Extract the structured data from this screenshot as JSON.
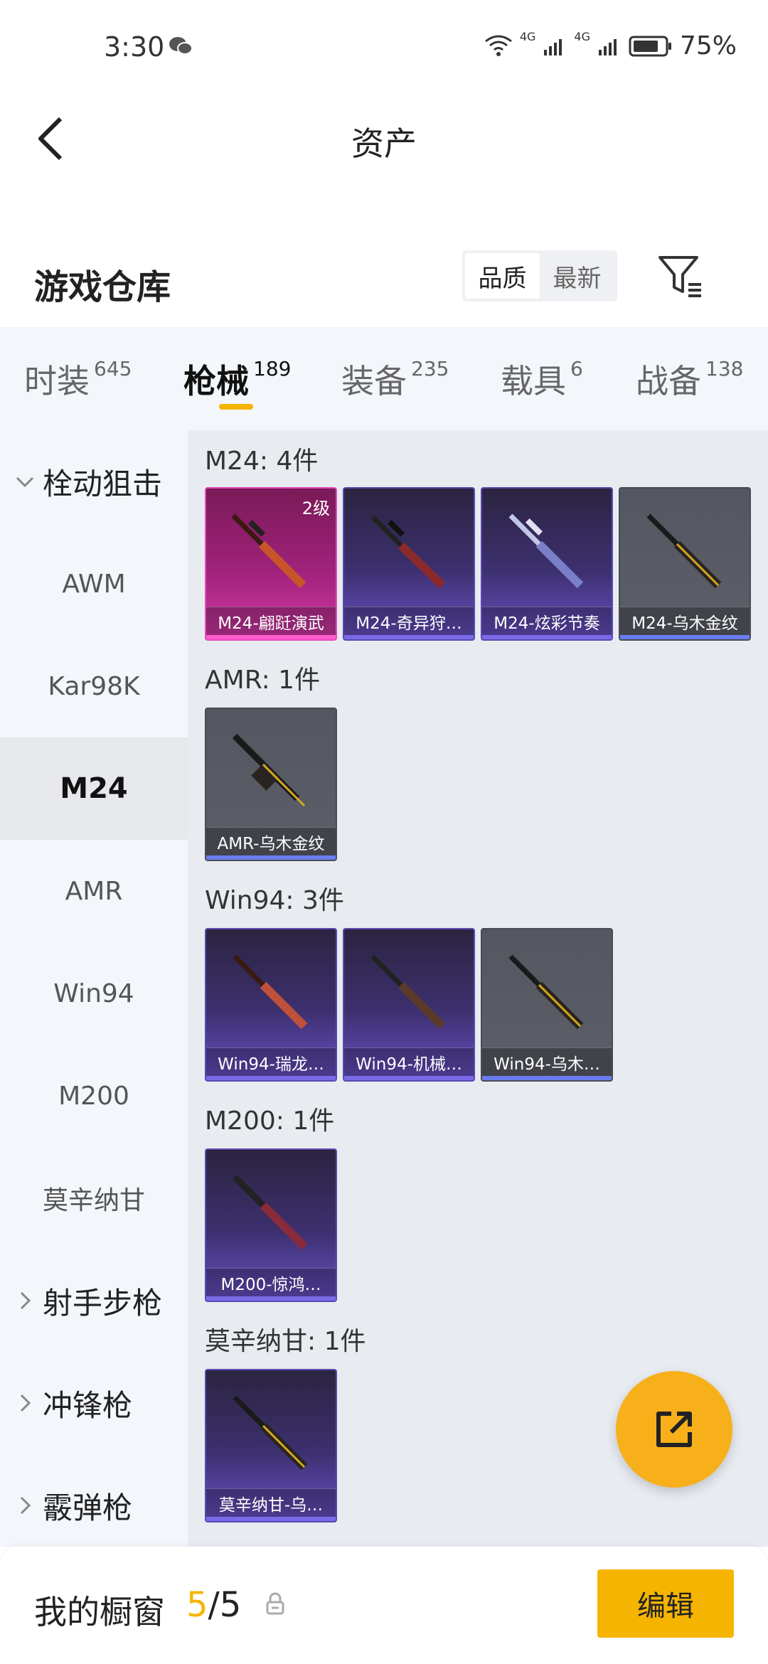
{
  "status_bar": {
    "time": "3:30",
    "network_1": "4G",
    "network_2": "4G",
    "battery": "75%"
  },
  "header": {
    "title": "资产"
  },
  "warehouse": {
    "title": "游戏仓库",
    "sort_options": [
      "品质",
      "最新"
    ],
    "sort_selected": "品质"
  },
  "tabs": [
    {
      "label": "时装",
      "count": "645"
    },
    {
      "label": "枪械",
      "count": "189"
    },
    {
      "label": "装备",
      "count": "235"
    },
    {
      "label": "载具",
      "count": "6"
    },
    {
      "label": "战备",
      "count": "138"
    }
  ],
  "active_tab": "枪械",
  "sidebar": {
    "group_open": "栓动狙击",
    "items": [
      "AWM",
      "Kar98K",
      "M24",
      "AMR",
      "Win94",
      "M200",
      "莫辛纳甘"
    ],
    "active_item": "M24",
    "groups_collapsed": [
      "射手步枪",
      "冲锋枪",
      "霰弹枪"
    ]
  },
  "sections": [
    {
      "title": "M24: 4件",
      "items": [
        {
          "name": "M24-翩跹演武",
          "level": "2级",
          "rarity": "pink"
        },
        {
          "name": "M24-奇异狩…",
          "rarity": "purple"
        },
        {
          "name": "M24-炫彩节奏",
          "rarity": "purple"
        },
        {
          "name": "M24-乌木金纹",
          "rarity": "gray"
        }
      ]
    },
    {
      "title": "AMR: 1件",
      "items": [
        {
          "name": "AMR-乌木金纹",
          "rarity": "gray"
        }
      ]
    },
    {
      "title": "Win94: 3件",
      "items": [
        {
          "name": "Win94-瑞龙…",
          "rarity": "purple"
        },
        {
          "name": "Win94-机械…",
          "rarity": "purple"
        },
        {
          "name": "Win94-乌木…",
          "rarity": "gray"
        }
      ]
    },
    {
      "title": "M200: 1件",
      "items": [
        {
          "name": "M200-惊鸿…",
          "rarity": "purple"
        }
      ]
    },
    {
      "title": "莫辛纳甘: 1件",
      "items": [
        {
          "name": "莫辛纳甘-乌…",
          "rarity": "purple"
        }
      ]
    }
  ],
  "bottom_bar": {
    "label": "我的橱窗",
    "current": "5",
    "separator": "/",
    "total": "5",
    "edit_label": "编辑"
  },
  "colors": {
    "accent": "#f5b400",
    "pink_rarity": "#d43aa8",
    "purple_rarity": "#5a49b0",
    "gray_rarity": "#5c5e68"
  }
}
